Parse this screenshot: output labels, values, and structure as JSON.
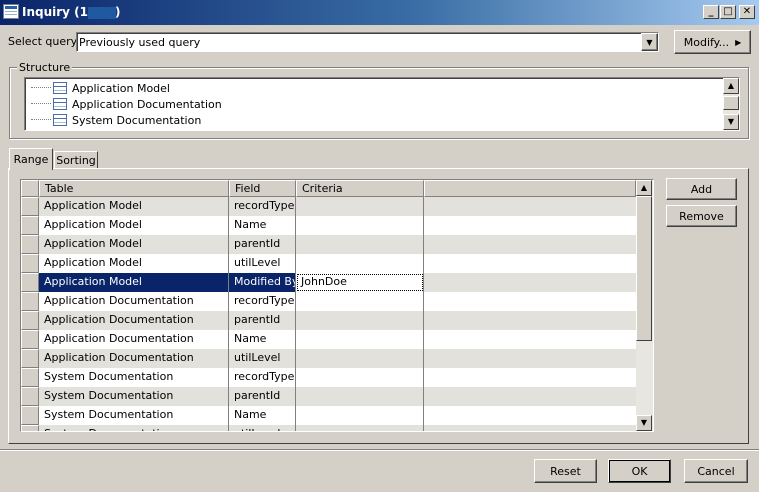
{
  "window": {
    "title": "Inquiry (1 -",
    "title_end": ")",
    "minimize": "_",
    "maximize": "□",
    "close": "✕"
  },
  "query": {
    "label": "Select query:",
    "value": "Previously used query",
    "modify_label": "Modify..."
  },
  "structure": {
    "label": "Structure",
    "items": [
      "Application Model",
      "Application Documentation",
      "System Documentation"
    ]
  },
  "tabs": [
    "Range",
    "Sorting"
  ],
  "grid": {
    "columns": [
      "Table",
      "Field",
      "Criteria",
      ""
    ],
    "rows": [
      {
        "table": "Application Model",
        "field": "recordType",
        "criteria": ""
      },
      {
        "table": "Application Model",
        "field": "Name",
        "criteria": ""
      },
      {
        "table": "Application Model",
        "field": "parentId",
        "criteria": ""
      },
      {
        "table": "Application Model",
        "field": "utilLevel",
        "criteria": ""
      },
      {
        "table": "Application Model",
        "field": "Modified By",
        "criteria": "JohnDoe"
      },
      {
        "table": "Application Documentation",
        "field": "recordType",
        "criteria": ""
      },
      {
        "table": "Application Documentation",
        "field": "parentId",
        "criteria": ""
      },
      {
        "table": "Application Documentation",
        "field": "Name",
        "criteria": ""
      },
      {
        "table": "Application Documentation",
        "field": "utilLevel",
        "criteria": ""
      },
      {
        "table": "System Documentation",
        "field": "recordType",
        "criteria": ""
      },
      {
        "table": "System Documentation",
        "field": "parentId",
        "criteria": ""
      },
      {
        "table": "System Documentation",
        "field": "Name",
        "criteria": ""
      },
      {
        "table": "System Documentation",
        "field": "utilLevel",
        "criteria": ""
      }
    ],
    "selected_row": 4
  },
  "side_buttons": {
    "add": "Add",
    "remove": "Remove"
  },
  "footer": {
    "reset": "Reset",
    "ok": "OK",
    "cancel": "Cancel"
  },
  "colors": {
    "selection": "#0a246a",
    "face": "#d4d0c8"
  }
}
